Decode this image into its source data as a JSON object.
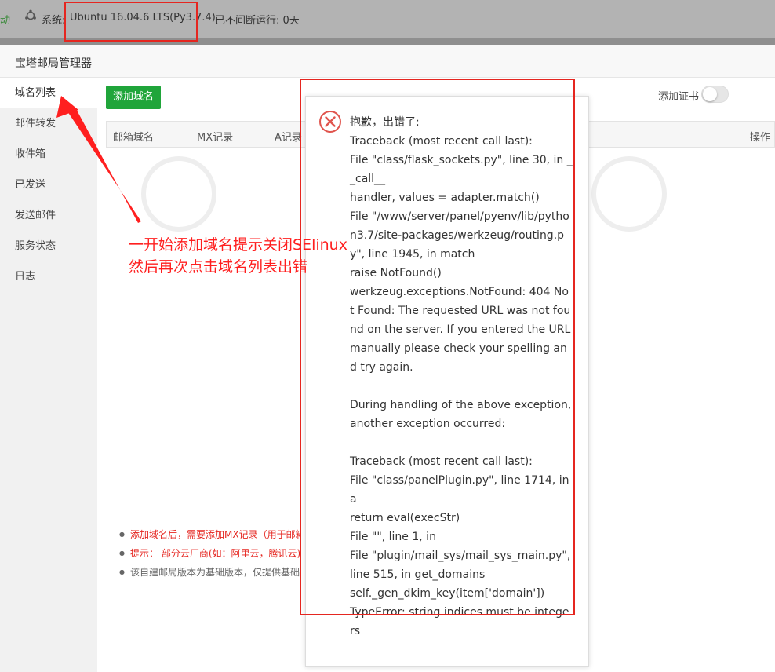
{
  "topbar": {
    "online_text": "动",
    "system_label": "系统:",
    "system_value": "Ubuntu 16.04.6 LTS(Py3.7.4)",
    "uptime_text": "已不间断运行: 0天"
  },
  "modal": {
    "title": "宝塔邮局管理器"
  },
  "sidebar": {
    "items": [
      {
        "label": "域名列表"
      },
      {
        "label": "邮件转发"
      },
      {
        "label": "收件箱"
      },
      {
        "label": "已发送"
      },
      {
        "label": "发送邮件"
      },
      {
        "label": "服务状态"
      },
      {
        "label": "日志"
      }
    ]
  },
  "toolbar": {
    "add_domain_label": "添加域名",
    "add_cert_label": "添加证书"
  },
  "table": {
    "headers": [
      "邮箱域名",
      "MX记录",
      "A记录",
      "操作"
    ]
  },
  "notes": [
    {
      "text": "添加域名后，需要添加MX记录（用于邮箱"
    },
    {
      "text": "提示： 部分云厂商(如：阿里云，腾讯云)默"
    },
    {
      "text": "该自建邮局版本为基础版本，仅提供基础功"
    }
  ],
  "error": {
    "title": "抱歉，出错了:",
    "message": "Traceback (most recent call last):\nFile \"class/flask_sockets.py\", line 30, in __call__\nhandler, values = adapter.match()\nFile \"/www/server/panel/pyenv/lib/python3.7/site-packages/werkzeug/routing.py\", line 1945, in match\nraise NotFound()\nwerkzeug.exceptions.NotFound: 404 Not Found: The requested URL was not found on the server. If you entered the URL manually please check your spelling and try again.\n\nDuring handling of the above exception, another exception occurred:\n\nTraceback (most recent call last):\nFile \"class/panelPlugin.py\", line 1714, in a\nreturn eval(execStr)\nFile \"\", line 1, in\nFile \"plugin/mail_sys/mail_sys_main.py\", line 515, in get_domains\nself._gen_dkim_key(item['domain'])\nTypeError: string indices must be integers"
  },
  "annotation": {
    "line1": "一开始添加域名提示关闭SElinux",
    "line2": "然后再次点击域名列表出错"
  },
  "colors": {
    "accent_green": "#20a53a",
    "highlight_red": "#e52620"
  }
}
